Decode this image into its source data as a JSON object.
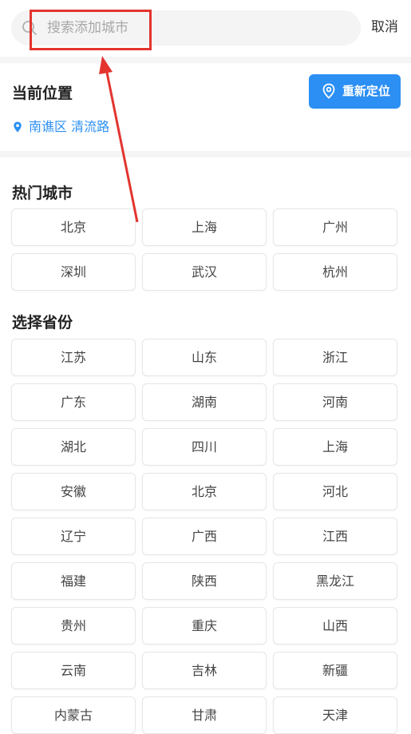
{
  "search": {
    "placeholder": "搜索添加城市",
    "cancel_label": "取消"
  },
  "current_location": {
    "title": "当前位置",
    "relocate_label": "重新定位",
    "location": "南谯区 清流路"
  },
  "hot_cities": {
    "title": "热门城市",
    "items": [
      "北京",
      "上海",
      "广州",
      "深圳",
      "武汉",
      "杭州"
    ]
  },
  "provinces": {
    "title": "选择省份",
    "items": [
      "江苏",
      "山东",
      "浙江",
      "广东",
      "湖南",
      "河南",
      "湖北",
      "四川",
      "上海",
      "安徽",
      "北京",
      "河北",
      "辽宁",
      "广西",
      "江西",
      "福建",
      "陕西",
      "黑龙江",
      "贵州",
      "重庆",
      "山西",
      "云南",
      "吉林",
      "新疆",
      "内蒙古",
      "甘肃",
      "天津"
    ]
  },
  "colors": {
    "accent": "#2b8ff3",
    "annotation": "#e3342f"
  }
}
